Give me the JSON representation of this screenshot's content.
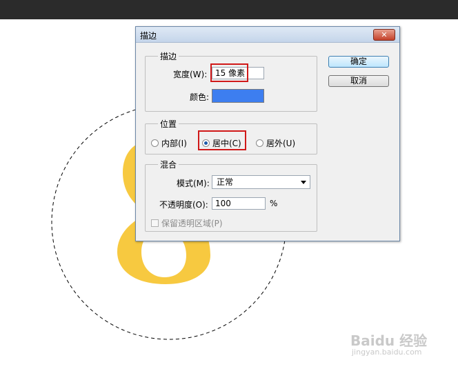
{
  "dialog": {
    "title": "描边",
    "close_symbol": "✕",
    "ok_label": "确定",
    "cancel_label": "取消",
    "stroke_group": {
      "legend": "描边",
      "width_label": "宽度(W):",
      "width_value": "15 像素",
      "color_label": "颜色:",
      "color_value": "#3d7ef0"
    },
    "position_group": {
      "legend": "位置",
      "options": [
        "内部(I)",
        "居中(C)",
        "居外(U)"
      ],
      "selected": "居中(C)"
    },
    "blend_group": {
      "legend": "混合",
      "mode_label": "模式(M):",
      "mode_value": "正常",
      "opacity_label": "不透明度(O):",
      "opacity_value": "100",
      "opacity_unit": "%",
      "preserve_label": "保留透明区域(P)",
      "preserve_checked": false
    }
  },
  "watermark": {
    "logo": "Baidu 经验",
    "url": "jingyan.baidu.com"
  },
  "colors": {
    "highlight": "#d01818",
    "glyph": "#f7c940"
  }
}
